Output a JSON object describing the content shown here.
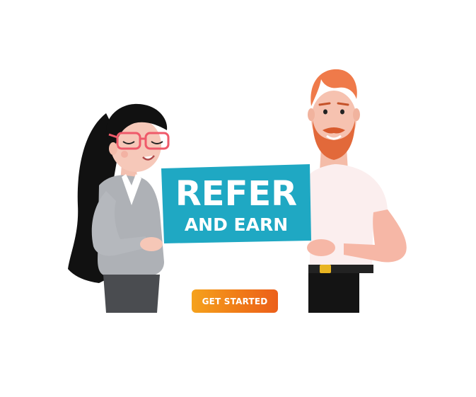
{
  "sign": {
    "line1": "REFER",
    "line2": "AND EARN"
  },
  "cta": {
    "label": "GET STARTED"
  },
  "colors": {
    "sign": "#1fa8c3",
    "cta_start": "#f5a21c",
    "cta_end": "#ec5f1a",
    "beard": "#e2693a",
    "hair_man": "#ef7a4a",
    "hair_woman": "#111111",
    "glasses": "#ef5a6a"
  },
  "icons": {
    "woman": "woman-illustration",
    "man": "man-illustration"
  }
}
